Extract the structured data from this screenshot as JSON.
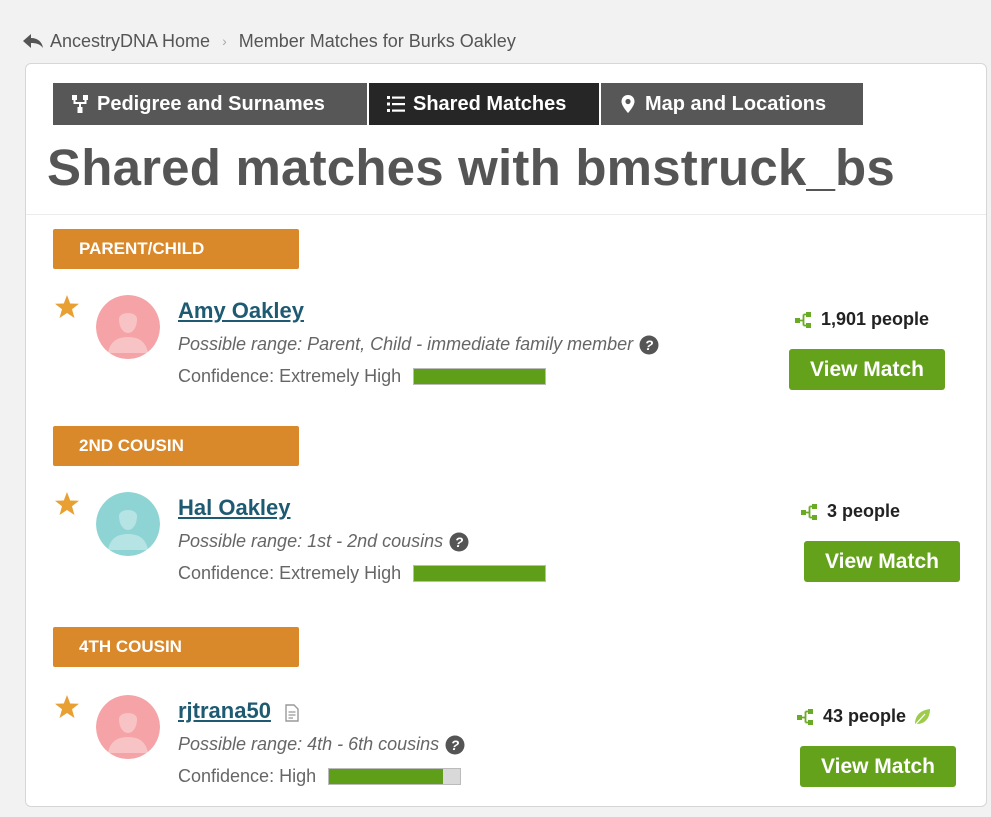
{
  "breadcrumb": {
    "home_label": "AncestryDNA Home",
    "current_label": "Member Matches for Burks Oakley"
  },
  "tabs": [
    {
      "label": "Pedigree and Surnames",
      "icon": "pedigree-icon",
      "active": false
    },
    {
      "label": "Shared Matches",
      "icon": "list-icon",
      "active": true
    },
    {
      "label": "Map and Locations",
      "icon": "map-pin-icon",
      "active": false
    }
  ],
  "page_title": "Shared matches with bmstruck_bs",
  "groups": [
    {
      "header": "PARENT/CHILD",
      "match": {
        "name": "Amy Oakley",
        "avatar_color": "#f5a3a6",
        "range": "Possible range: Parent, Child - immediate family member",
        "confidence": "Confidence: Extremely High",
        "confidence_level": 1.0,
        "shared_people": "1,901 people",
        "view_label": "View Match"
      }
    },
    {
      "header": "2ND COUSIN",
      "match": {
        "name": "Hal Oakley",
        "avatar_color": "#8fd4d4",
        "range": "Possible range: 1st - 2nd cousins",
        "confidence": "Confidence: Extremely High",
        "confidence_level": 1.0,
        "shared_people": "3 people",
        "view_label": "View Match"
      }
    },
    {
      "header": "4TH COUSIN",
      "match": {
        "name": "rjtrana50",
        "avatar_color": "#f5a3a6",
        "range": "Possible range: 4th - 6th cousins",
        "confidence": "Confidence: High",
        "confidence_level": 0.87,
        "shared_people": "43 people",
        "view_label": "View Match"
      }
    }
  ],
  "colors": {
    "accent_orange": "#d9882a",
    "button_green": "#64a21c",
    "confidence_green": "#5f9e18",
    "link_blue": "#1e5a72",
    "tab_dark": "#262626",
    "tab_gray": "#575757"
  }
}
